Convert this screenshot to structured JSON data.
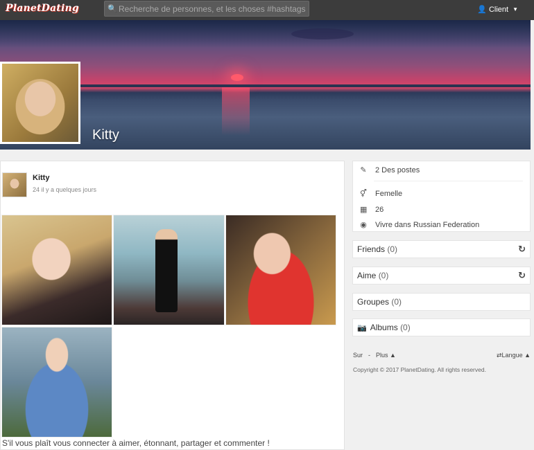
{
  "nav": {
    "logo": "PlanetDating",
    "search_placeholder": "Recherche de personnes, et les choses #hashtags",
    "user_label": "Client"
  },
  "profile": {
    "name": "Kitty"
  },
  "post": {
    "author": "Kitty",
    "time": "24 il y a quelques jours",
    "cta": "S'il vous plaît vous connecter à aimer, étonnant, partager et commenter !"
  },
  "info": {
    "posts": "2 Des postes",
    "gender": "Femelle",
    "age": "26",
    "location": "Vivre dans Russian Federation"
  },
  "widgets": {
    "friends": {
      "label": "Friends",
      "count": "(0)"
    },
    "likes": {
      "label": "Aime",
      "count": "(0)"
    },
    "groups": {
      "label": "Groupes",
      "count": "(0)"
    },
    "albums": {
      "label": "Albums",
      "count": "(0)"
    }
  },
  "footer": {
    "about": "Sur",
    "sep": "-",
    "more": "Plus",
    "language": "Langue",
    "copyright": "Copyright © 2017 PlanetDating. All rights reserved."
  }
}
